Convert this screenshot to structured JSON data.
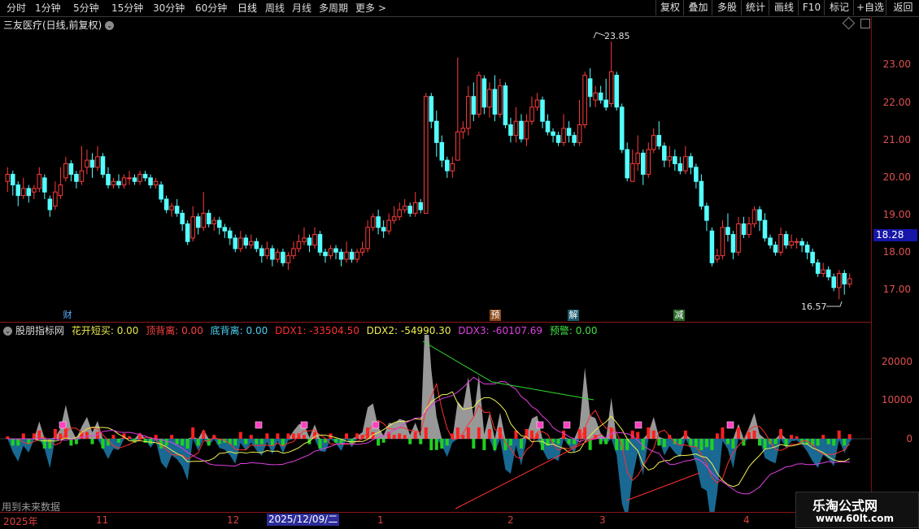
{
  "toolbar": {
    "periods": [
      "分时",
      "1分钟",
      "5分钟",
      "15分钟",
      "30分钟",
      "60分钟",
      "日线",
      "周线",
      "月线",
      "多周期",
      "更多 >"
    ],
    "right_buttons": [
      "复权",
      "叠加",
      "多股",
      "统计",
      "画线",
      "F10",
      "标记",
      "+自选",
      "返回"
    ]
  },
  "chart_title": "三友医疗(日线,前复权)",
  "price_axis": [
    "23.00",
    "22.00",
    "21.00",
    "20.00",
    "19.00",
    "18.00",
    "17.00"
  ],
  "current_price": "18.28",
  "high_label": "23.85",
  "low_label": "16.57",
  "events": [
    {
      "label": "财",
      "color": "#5fb0ff",
      "bg": "#000"
    },
    {
      "label": "预",
      "color": "#ffffff",
      "bg": "#8a4a1a"
    },
    {
      "label": "解",
      "color": "#ffffff",
      "bg": "#1a5a6a"
    },
    {
      "label": "减",
      "color": "#ffffff",
      "bg": "#2a6a2a"
    }
  ],
  "indicator": {
    "name": "股朋指标网",
    "items": [
      {
        "text": "花开短买: 0.00",
        "color": "#e8e84a"
      },
      {
        "text": "顶背离: 0.00",
        "color": "#ff4040"
      },
      {
        "text": "底背离: 0.00",
        "color": "#4ad0f0"
      },
      {
        "text": "DDX1: -33504.50",
        "color": "#ff3030"
      },
      {
        "text": "DDX2: -54990.30",
        "color": "#f0f050"
      },
      {
        "text": "DDX3: -60107.69",
        "color": "#e040e0"
      },
      {
        "text": "预警: 0.00",
        "color": "#40e040"
      }
    ],
    "axis": [
      "20000",
      "10000",
      "0"
    ]
  },
  "x_axis": [
    "2025年",
    "11",
    "12",
    "1",
    "2",
    "3",
    "4"
  ],
  "x_selected": "2025/12/09/二",
  "note": "用到未来数据",
  "watermark": {
    "title": "乐淘公式网",
    "url": "www.60lt.com"
  },
  "chart_data": {
    "type": "candlestick",
    "y_range": [
      16.3,
      24.2
    ],
    "candles": [
      [
        19.9,
        20.1,
        20.3,
        19.6
      ],
      [
        20.1,
        19.8,
        20.2,
        19.5
      ],
      [
        19.8,
        19.5,
        19.9,
        19.2
      ],
      [
        19.5,
        19.7,
        20.0,
        19.4
      ],
      [
        19.7,
        19.5,
        19.8,
        19.3
      ],
      [
        19.6,
        19.7,
        19.8,
        19.4
      ],
      [
        19.7,
        20.1,
        20.3,
        19.6
      ],
      [
        20.0,
        19.6,
        20.1,
        19.4
      ],
      [
        19.4,
        19.1,
        19.5,
        18.9
      ],
      [
        19.2,
        19.6,
        19.9,
        19.1
      ],
      [
        19.5,
        19.8,
        20.3,
        19.4
      ],
      [
        20.0,
        20.4,
        20.6,
        19.9
      ],
      [
        20.4,
        20.1,
        20.5,
        19.9
      ],
      [
        20.1,
        19.9,
        20.2,
        19.7
      ],
      [
        19.9,
        20.2,
        20.9,
        19.8
      ],
      [
        20.3,
        20.5,
        20.8,
        20.1
      ],
      [
        20.5,
        20.3,
        20.7,
        20.0
      ],
      [
        20.3,
        20.6,
        20.9,
        20.2
      ],
      [
        20.6,
        20.1,
        20.7,
        20.0
      ],
      [
        20.1,
        19.8,
        20.3,
        19.7
      ],
      [
        19.8,
        19.9,
        20.0,
        19.7
      ],
      [
        19.9,
        19.8,
        20.1,
        19.7
      ],
      [
        19.8,
        20.0,
        20.1,
        19.7
      ],
      [
        20.0,
        20.0,
        20.2,
        19.8
      ],
      [
        20.0,
        19.9,
        20.1,
        19.8
      ],
      [
        19.9,
        20.1,
        20.2,
        19.8
      ],
      [
        20.1,
        20.0,
        20.2,
        19.9
      ],
      [
        20.0,
        19.8,
        20.1,
        19.7
      ],
      [
        19.8,
        19.9,
        20.0,
        19.7
      ],
      [
        19.8,
        19.4,
        19.9,
        19.3
      ],
      [
        19.4,
        19.1,
        19.5,
        19.0
      ],
      [
        19.1,
        19.2,
        19.3,
        18.9
      ],
      [
        19.2,
        19.0,
        19.4,
        18.9
      ],
      [
        19.0,
        18.7,
        19.1,
        18.5
      ],
      [
        18.7,
        18.2,
        18.8,
        18.1
      ],
      [
        18.3,
        18.9,
        19.2,
        18.2
      ],
      [
        18.9,
        18.6,
        19.0,
        18.4
      ],
      [
        18.6,
        19.0,
        19.6,
        18.5
      ],
      [
        19.0,
        18.7,
        19.1,
        18.6
      ],
      [
        18.7,
        18.8,
        18.9,
        18.5
      ],
      [
        18.8,
        18.6,
        18.9,
        18.4
      ],
      [
        18.6,
        18.5,
        18.7,
        18.3
      ],
      [
        18.5,
        18.3,
        18.6,
        18.1
      ],
      [
        18.3,
        18.0,
        18.4,
        17.9
      ],
      [
        18.0,
        18.3,
        18.5,
        17.9
      ],
      [
        18.3,
        18.1,
        18.4,
        18.0
      ],
      [
        18.1,
        18.2,
        18.4,
        18.0
      ],
      [
        18.2,
        18.0,
        18.3,
        17.9
      ],
      [
        18.0,
        17.8,
        18.1,
        17.6
      ],
      [
        17.8,
        18.0,
        18.2,
        17.7
      ],
      [
        18.0,
        17.7,
        18.1,
        17.5
      ],
      [
        17.7,
        17.9,
        18.0,
        17.6
      ],
      [
        17.9,
        17.6,
        18.0,
        17.5
      ],
      [
        17.6,
        17.8,
        17.9,
        17.4
      ],
      [
        17.8,
        18.0,
        18.2,
        17.7
      ],
      [
        18.0,
        18.2,
        18.4,
        17.9
      ],
      [
        18.2,
        18.3,
        18.6,
        18.1
      ],
      [
        18.3,
        18.1,
        18.4,
        17.9
      ],
      [
        18.1,
        18.4,
        18.6,
        18.0
      ],
      [
        18.4,
        17.9,
        18.5,
        17.8
      ],
      [
        17.9,
        17.8,
        18.0,
        17.6
      ],
      [
        17.8,
        18.0,
        18.1,
        17.7
      ],
      [
        18.0,
        17.9,
        18.1,
        17.7
      ],
      [
        17.9,
        17.7,
        18.0,
        17.5
      ],
      [
        17.7,
        17.9,
        18.2,
        17.6
      ],
      [
        17.9,
        17.7,
        18.0,
        17.6
      ],
      [
        17.7,
        17.9,
        18.0,
        17.6
      ],
      [
        17.9,
        18.0,
        18.2,
        17.8
      ],
      [
        18.0,
        18.6,
        18.8,
        17.9
      ],
      [
        18.6,
        18.9,
        19.0,
        18.5
      ],
      [
        18.9,
        18.6,
        19.1,
        18.4
      ],
      [
        18.6,
        18.5,
        18.8,
        18.3
      ],
      [
        18.5,
        18.8,
        19.0,
        18.4
      ],
      [
        18.8,
        18.9,
        19.2,
        18.7
      ],
      [
        18.9,
        19.1,
        19.3,
        18.8
      ],
      [
        19.1,
        19.2,
        19.4,
        19.0
      ],
      [
        19.2,
        19.0,
        19.3,
        18.9
      ],
      [
        19.0,
        19.3,
        19.6,
        18.9
      ],
      [
        19.3,
        19.1,
        19.4,
        19.0
      ],
      [
        19.0,
        22.3,
        22.4,
        19.0
      ],
      [
        22.3,
        21.6,
        22.4,
        21.4
      ],
      [
        21.6,
        21.0,
        21.9,
        20.6
      ],
      [
        21.0,
        20.5,
        21.2,
        20.3
      ],
      [
        20.5,
        20.2,
        20.6,
        20.0
      ],
      [
        20.2,
        20.4,
        20.6,
        20.0
      ],
      [
        20.5,
        21.3,
        23.4,
        20.6
      ],
      [
        21.3,
        21.4,
        21.6,
        21.1
      ],
      [
        21.4,
        22.3,
        22.6,
        21.2
      ],
      [
        22.3,
        21.8,
        22.7,
        21.6
      ],
      [
        21.8,
        22.9,
        23.0,
        21.7
      ],
      [
        22.8,
        22.0,
        22.9,
        21.8
      ],
      [
        22.0,
        22.5,
        22.7,
        21.7
      ],
      [
        22.5,
        21.8,
        22.9,
        21.6
      ],
      [
        21.8,
        22.6,
        22.8,
        21.7
      ],
      [
        22.6,
        21.5,
        22.7,
        21.4
      ],
      [
        21.5,
        21.2,
        21.7,
        21.0
      ],
      [
        21.2,
        21.6,
        22.0,
        21.0
      ],
      [
        21.6,
        21.1,
        21.8,
        21.0
      ],
      [
        21.1,
        21.6,
        21.8,
        20.9
      ],
      [
        21.6,
        22.0,
        22.3,
        21.5
      ],
      [
        22.0,
        22.2,
        22.4,
        21.9
      ],
      [
        22.2,
        21.6,
        22.3,
        21.4
      ],
      [
        21.6,
        21.3,
        21.8,
        21.2
      ],
      [
        21.3,
        21.2,
        21.4,
        21.0
      ],
      [
        21.2,
        21.0,
        21.3,
        20.9
      ],
      [
        21.0,
        21.4,
        21.8,
        20.9
      ],
      [
        21.4,
        21.2,
        21.6,
        21.0
      ],
      [
        21.2,
        21.0,
        21.3,
        20.9
      ],
      [
        21.0,
        21.5,
        22.2,
        20.9
      ],
      [
        21.5,
        22.9,
        23.0,
        21.4
      ],
      [
        22.8,
        22.3,
        23.1,
        22.0
      ],
      [
        22.2,
        22.4,
        22.6,
        22.0
      ],
      [
        22.4,
        22.2,
        22.6,
        22.1
      ],
      [
        22.2,
        22.0,
        22.8,
        21.9
      ],
      [
        22.1,
        23.0,
        23.85,
        22.0
      ],
      [
        22.9,
        22.0,
        23.0,
        21.9
      ],
      [
        22.0,
        20.8,
        22.1,
        20.7
      ],
      [
        20.8,
        20.0,
        21.0,
        19.9
      ],
      [
        19.9,
        20.4,
        20.8,
        19.9
      ],
      [
        20.4,
        20.7,
        21.2,
        20.2
      ],
      [
        20.7,
        20.1,
        20.8,
        19.8
      ],
      [
        20.1,
        20.8,
        21.0,
        20.0
      ],
      [
        20.8,
        21.2,
        21.4,
        20.7
      ],
      [
        21.2,
        20.9,
        21.6,
        20.8
      ],
      [
        20.9,
        20.5,
        21.0,
        20.3
      ],
      [
        20.5,
        20.6,
        20.9,
        20.3
      ],
      [
        20.6,
        20.4,
        20.8,
        20.2
      ],
      [
        20.4,
        20.2,
        20.6,
        20.1
      ],
      [
        20.2,
        20.6,
        20.9,
        20.1
      ],
      [
        20.6,
        20.3,
        20.7,
        20.1
      ],
      [
        20.3,
        19.9,
        20.4,
        19.7
      ],
      [
        19.9,
        19.2,
        20.1,
        19.1
      ],
      [
        19.2,
        18.8,
        19.3,
        18.5
      ],
      [
        18.5,
        17.6,
        18.6,
        17.5
      ],
      [
        17.7,
        17.8,
        18.0,
        17.6
      ],
      [
        17.8,
        18.6,
        18.8,
        17.7
      ],
      [
        18.6,
        18.4,
        19.0,
        18.2
      ],
      [
        18.4,
        17.9,
        18.5,
        17.7
      ],
      [
        17.9,
        18.7,
        18.9,
        17.8
      ],
      [
        18.7,
        18.4,
        18.9,
        18.3
      ],
      [
        18.4,
        18.7,
        18.9,
        18.3
      ],
      [
        18.7,
        19.1,
        19.2,
        18.6
      ],
      [
        19.1,
        18.8,
        19.2,
        18.5
      ],
      [
        18.8,
        18.3,
        19.0,
        18.2
      ],
      [
        18.3,
        18.1,
        18.4,
        18.0
      ],
      [
        18.1,
        17.9,
        18.2,
        17.8
      ],
      [
        17.9,
        18.4,
        18.6,
        17.8
      ],
      [
        18.4,
        18.1,
        18.5,
        18.0
      ],
      [
        18.1,
        18.2,
        18.4,
        18.0
      ],
      [
        18.2,
        18.2,
        18.3,
        18.0
      ],
      [
        18.2,
        18.1,
        18.3,
        17.9
      ],
      [
        18.1,
        17.9,
        18.2,
        17.7
      ],
      [
        17.9,
        17.6,
        18.0,
        17.5
      ],
      [
        17.6,
        17.3,
        17.7,
        17.2
      ],
      [
        17.3,
        17.4,
        17.6,
        17.2
      ],
      [
        17.4,
        17.2,
        17.5,
        17.1
      ],
      [
        17.2,
        16.9,
        17.3,
        16.8
      ],
      [
        16.9,
        17.3,
        17.4,
        16.57
      ],
      [
        17.3,
        17.0,
        17.4,
        16.7
      ],
      [
        17.0,
        17.15,
        17.3,
        16.9
      ]
    ]
  }
}
